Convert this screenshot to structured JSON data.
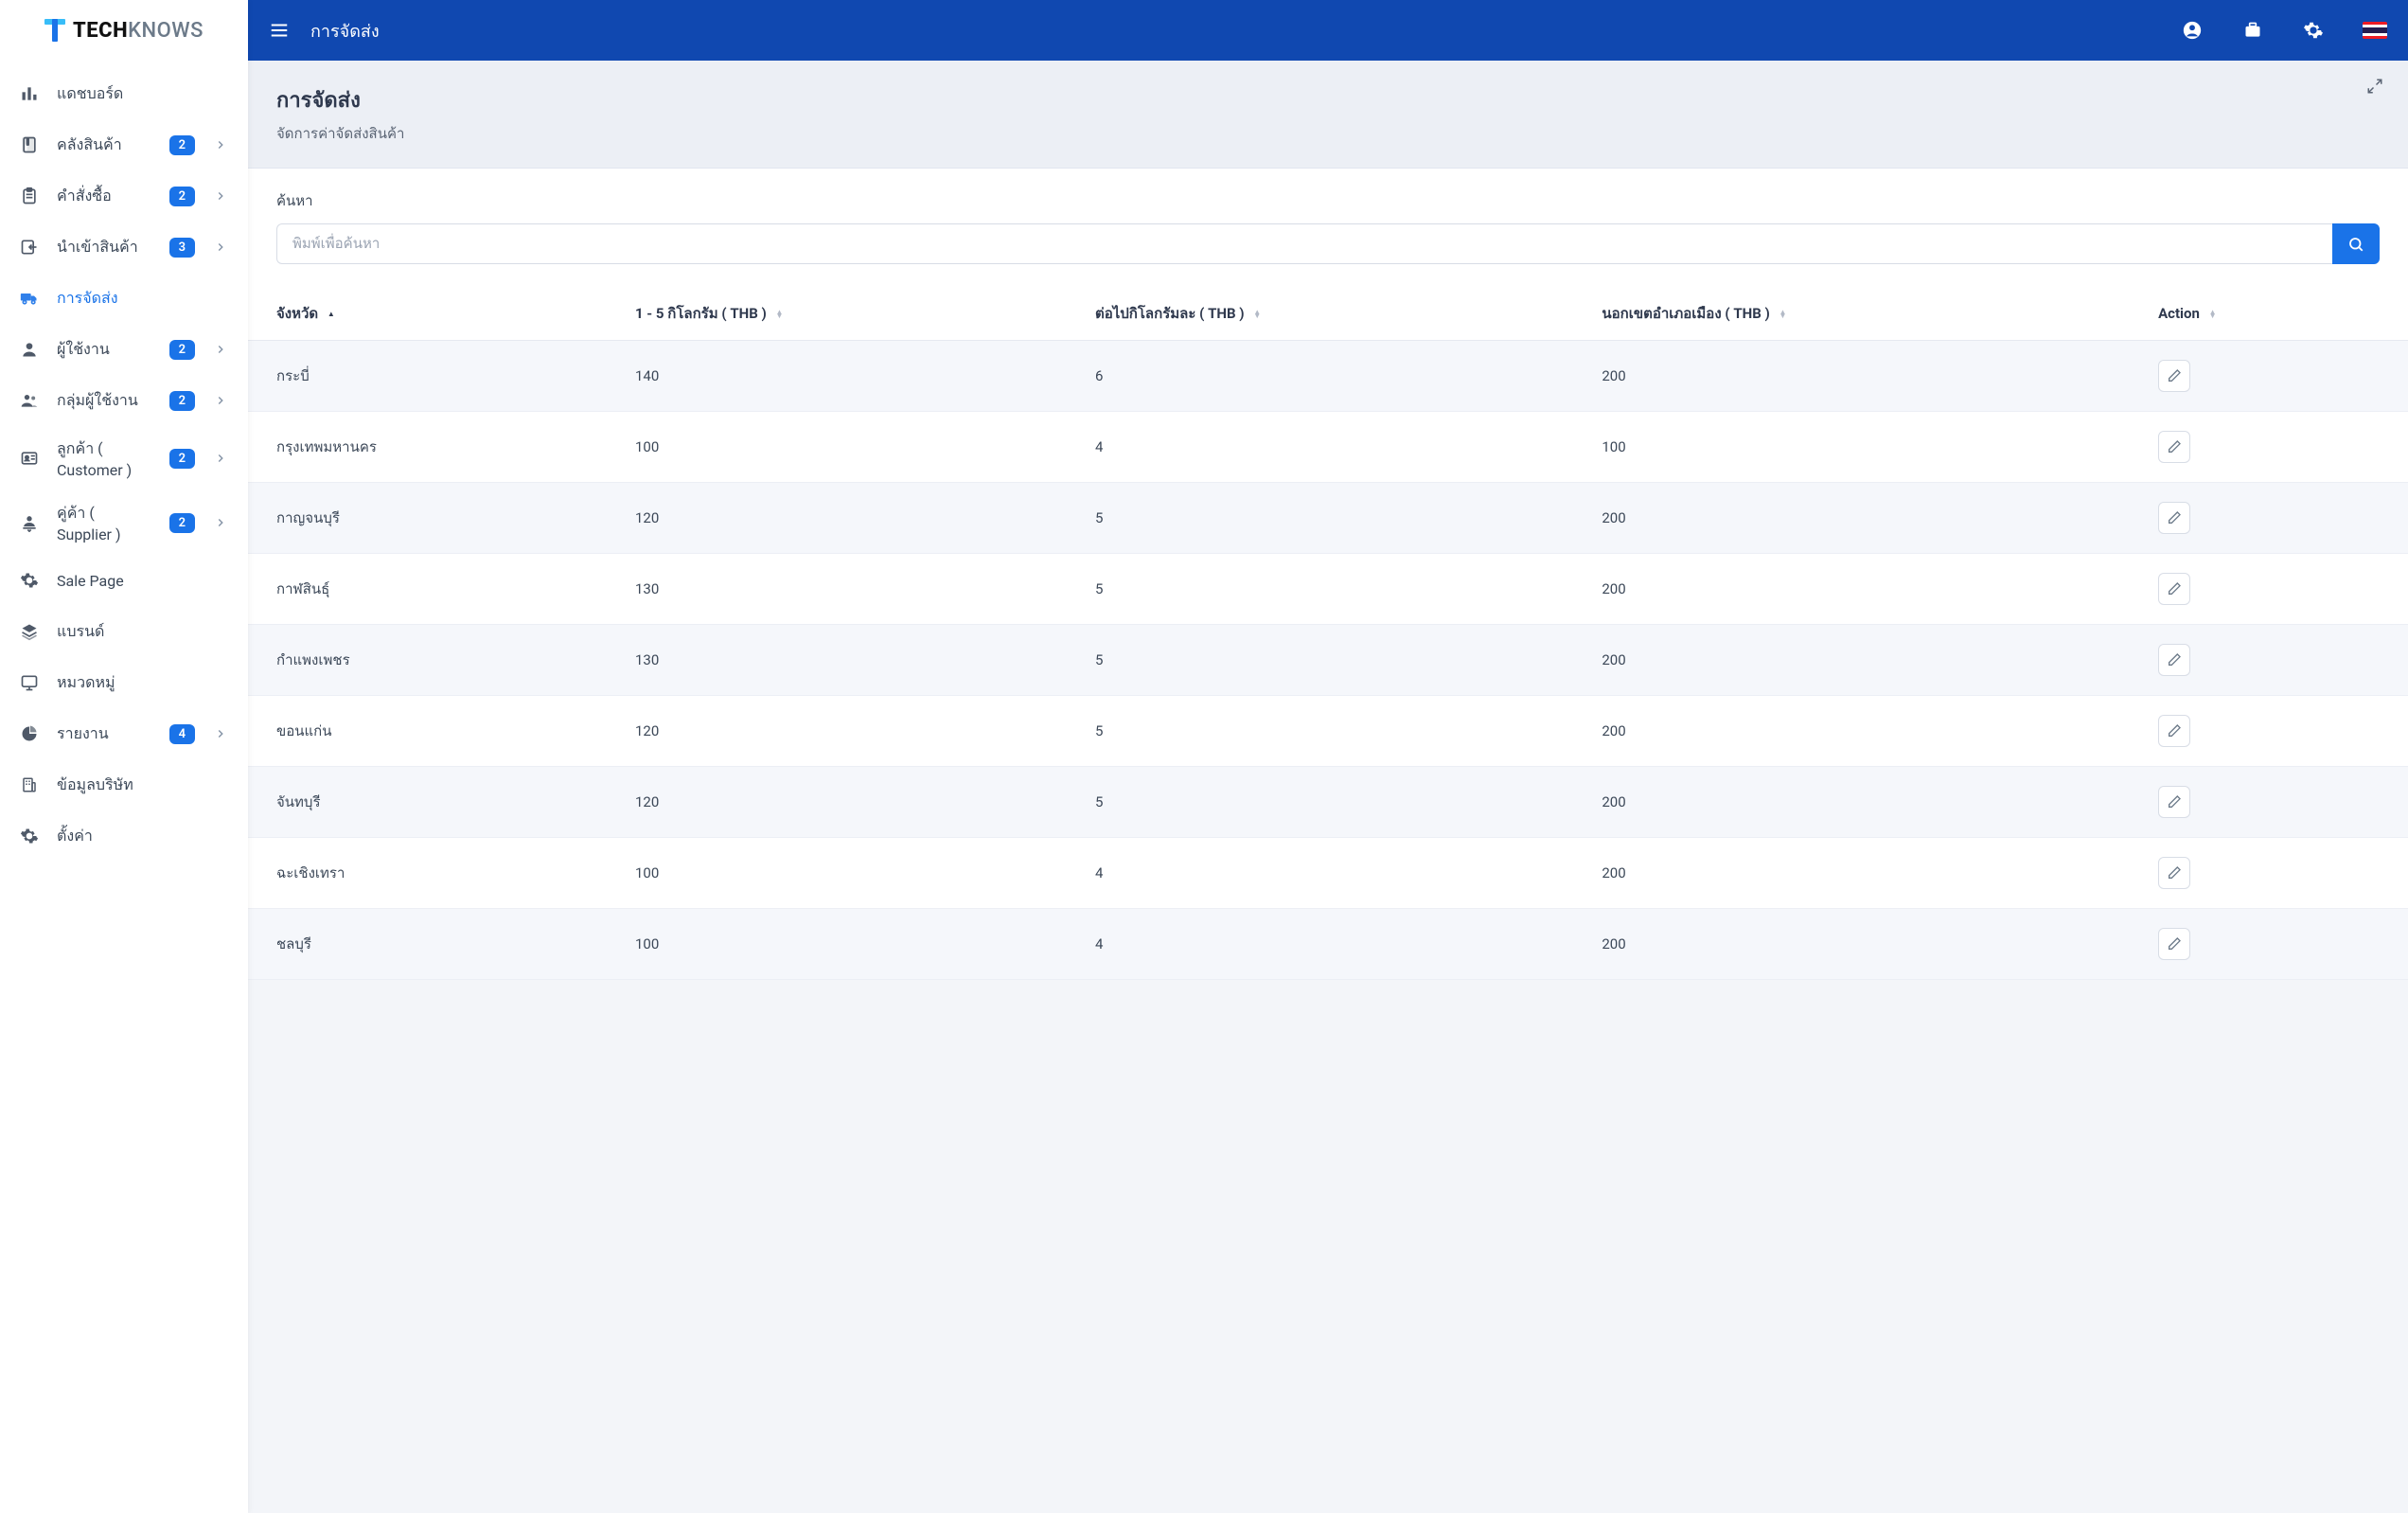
{
  "brand": {
    "name_bold": "TECH",
    "name_light": "KNOWS"
  },
  "topbar": {
    "title": "การจัดส่ง",
    "locale_flag": "th"
  },
  "sidebar": {
    "items": [
      {
        "icon": "bar-chart-icon",
        "label": "แดชบอร์ด",
        "badge": null,
        "expandable": false
      },
      {
        "icon": "box-icon",
        "label": "คลังสินค้า",
        "badge": "2",
        "expandable": true
      },
      {
        "icon": "clipboard-icon",
        "label": "คำสั่งซื้อ",
        "badge": "2",
        "expandable": true
      },
      {
        "icon": "import-icon",
        "label": "นำเข้าสินค้า",
        "badge": "3",
        "expandable": true
      },
      {
        "icon": "truck-icon",
        "label": "การจัดส่ง",
        "badge": null,
        "expandable": false,
        "active": true
      },
      {
        "icon": "user-icon",
        "label": "ผู้ใช้งาน",
        "badge": "2",
        "expandable": true
      },
      {
        "icon": "users-icon",
        "label": "กลุ่มผู้ใช้งาน",
        "badge": "2",
        "expandable": true
      },
      {
        "icon": "id-card-icon",
        "label": "ลูกค้า ( Customer )",
        "badge": "2",
        "expandable": true
      },
      {
        "icon": "supplier-icon",
        "label": "คู่ค้า ( Supplier )",
        "badge": "2",
        "expandable": true
      },
      {
        "icon": "gear-icon",
        "label": "Sale Page",
        "badge": null,
        "expandable": false
      },
      {
        "icon": "layers-icon",
        "label": "แบรนด์",
        "badge": null,
        "expandable": false
      },
      {
        "icon": "screen-icon",
        "label": "หมวดหมู่",
        "badge": null,
        "expandable": false
      },
      {
        "icon": "pie-icon",
        "label": "รายงาน",
        "badge": "4",
        "expandable": true
      },
      {
        "icon": "company-icon",
        "label": "ข้อมูลบริษัท",
        "badge": null,
        "expandable": false
      },
      {
        "icon": "settings-icon",
        "label": "ตั้งค่า",
        "badge": null,
        "expandable": false
      }
    ]
  },
  "page": {
    "title": "การจัดส่ง",
    "subtitle": "จัดการค่าจัดส่งสินค้า",
    "search_label": "ค้นหา",
    "search_placeholder": "พิมพ์เพื่อค้นหา"
  },
  "table": {
    "columns": {
      "province": "จังหวัด",
      "first_kg": "1 - 5 กิโลกรัม ( THB )",
      "next_kg": "ต่อไปกิโลกรัมละ ( THB )",
      "outside": "นอกเขตอำเภอเมือง ( THB )",
      "action": "Action"
    },
    "rows": [
      {
        "province": "กระบี่",
        "first_kg": "140",
        "next_kg": "6",
        "outside": "200"
      },
      {
        "province": "กรุงเทพมหานคร",
        "first_kg": "100",
        "next_kg": "4",
        "outside": "100"
      },
      {
        "province": "กาญจนบุรี",
        "first_kg": "120",
        "next_kg": "5",
        "outside": "200"
      },
      {
        "province": "กาฬสินธุ์",
        "first_kg": "130",
        "next_kg": "5",
        "outside": "200"
      },
      {
        "province": "กำแพงเพชร",
        "first_kg": "130",
        "next_kg": "5",
        "outside": "200"
      },
      {
        "province": "ขอนแก่น",
        "first_kg": "120",
        "next_kg": "5",
        "outside": "200"
      },
      {
        "province": "จันทบุรี",
        "first_kg": "120",
        "next_kg": "5",
        "outside": "200"
      },
      {
        "province": "ฉะเชิงเทรา",
        "first_kg": "100",
        "next_kg": "4",
        "outside": "200"
      },
      {
        "province": "ชลบุรี",
        "first_kg": "100",
        "next_kg": "4",
        "outside": "200"
      }
    ]
  }
}
